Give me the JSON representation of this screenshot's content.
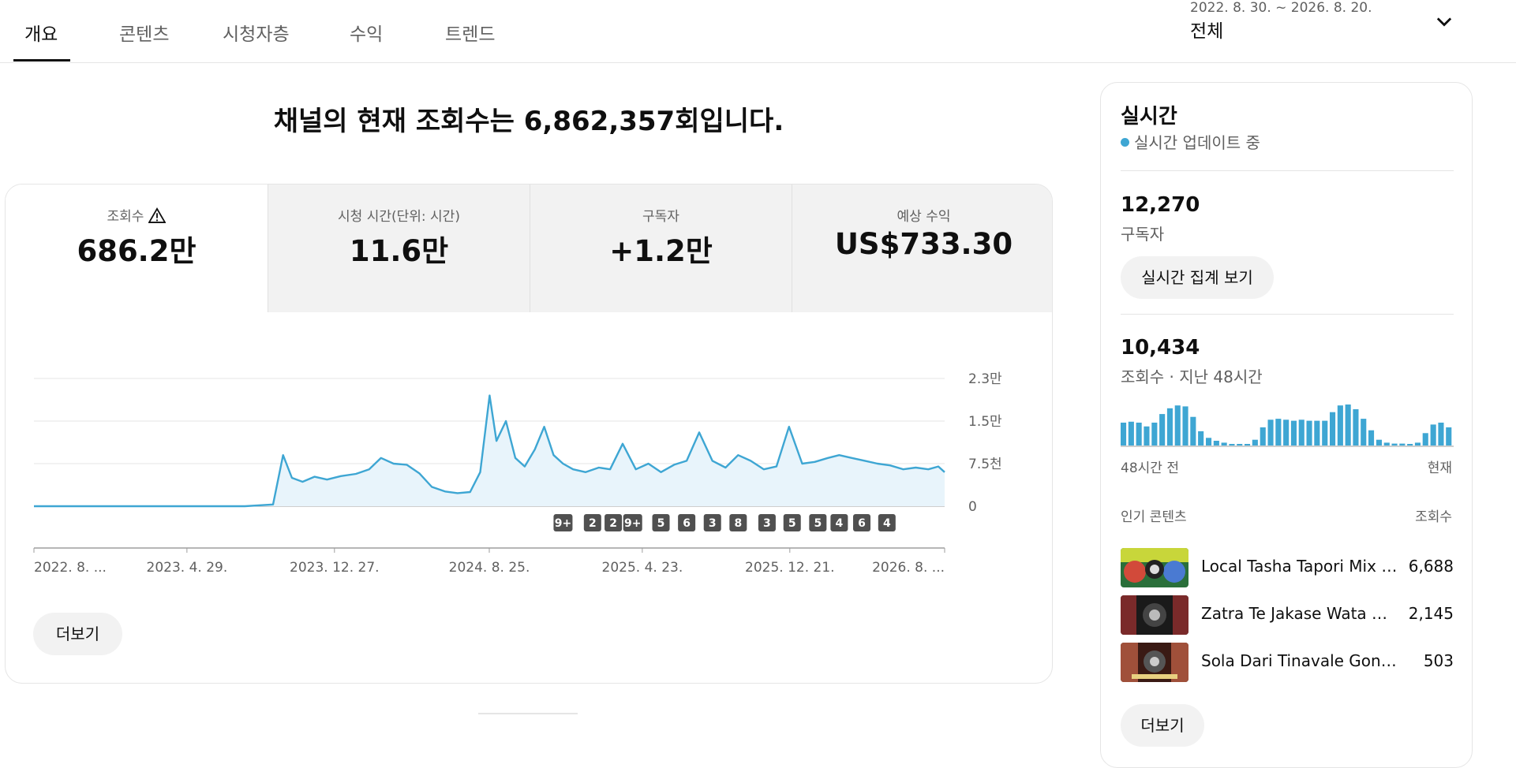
{
  "tabs": [
    {
      "label": "개요",
      "active": true
    },
    {
      "label": "콘텐츠"
    },
    {
      "label": "시청자층"
    },
    {
      "label": "수익"
    },
    {
      "label": "트렌드"
    }
  ],
  "date_range": {
    "range": "2022. 8. 30. ~ 2026. 8. 20.",
    "value": "전체"
  },
  "headline": "채널의 현재 조회수는 6,862,357회입니다.",
  "metrics": [
    {
      "label": "조회수",
      "value": "686.2만"
    },
    {
      "label": "시청 시간(단위: 시간)",
      "value": "11.6만"
    },
    {
      "label": "구독자",
      "value": "+1.2만"
    },
    {
      "label": "예상 수익",
      "value": "US$733.30"
    }
  ],
  "main_more_label": "더보기",
  "colors": {
    "accent": "#3ea6d3",
    "accent_fill": "#e8f4fb",
    "marker": "#505050"
  },
  "chart_data": {
    "type": "line",
    "x_tick_labels": [
      "2022. 8. ...",
      "2023. 4. 29.",
      "2023. 12. 27.",
      "2024. 8. 25.",
      "2025. 4. 23.",
      "2025. 12. 21.",
      "2026. 8. ..."
    ],
    "x_range": [
      "2022-08-30",
      "2026-08-20"
    ],
    "y_tick_labels": [
      "0",
      "7.5천",
      "1.5만",
      "2.3만"
    ],
    "y_ticks": [
      0,
      7500,
      15000,
      22500
    ],
    "ylim": [
      0,
      22500
    ],
    "grid": true,
    "series": [
      {
        "x": [
          "2022-08-30",
          "2023-08-01",
          "2023-09-15",
          "2023-10-01",
          "2023-10-15",
          "2023-11-01",
          "2023-11-20",
          "2023-12-10",
          "2024-01-01",
          "2024-01-25",
          "2024-02-15",
          "2024-03-05",
          "2024-03-25",
          "2024-04-15",
          "2024-05-05",
          "2024-05-25",
          "2024-06-15",
          "2024-07-05",
          "2024-07-25",
          "2024-08-10",
          "2024-08-25",
          "2024-09-05",
          "2024-09-20",
          "2024-10-05",
          "2024-10-20",
          "2024-11-05",
          "2024-11-20",
          "2024-12-05",
          "2024-12-20",
          "2025-01-05",
          "2025-01-25",
          "2025-02-15",
          "2025-03-05",
          "2025-03-25",
          "2025-04-15",
          "2025-05-05",
          "2025-05-25",
          "2025-06-15",
          "2025-07-05",
          "2025-07-25",
          "2025-08-15",
          "2025-09-05",
          "2025-09-25",
          "2025-10-15",
          "2025-11-05",
          "2025-11-25",
          "2025-12-15",
          "2026-01-05",
          "2026-01-25",
          "2026-02-15",
          "2026-03-05",
          "2026-03-25",
          "2026-04-15",
          "2026-05-05",
          "2026-05-25",
          "2026-06-15",
          "2026-07-05",
          "2026-07-25",
          "2026-08-10",
          "2026-08-20"
        ],
        "values": [
          0,
          0,
          300,
          9000,
          5000,
          4300,
          5200,
          4700,
          5300,
          5700,
          6500,
          8500,
          7500,
          7300,
          5800,
          3400,
          2600,
          2300,
          2500,
          6000,
          19500,
          11500,
          15000,
          8500,
          7000,
          10000,
          14000,
          9000,
          7500,
          6500,
          6000,
          6800,
          6500,
          11000,
          6500,
          7500,
          6000,
          7300,
          8000,
          13000,
          8000,
          6800,
          9000,
          8000,
          6500,
          7000,
          14000,
          7500,
          7800,
          8500,
          9000,
          8500,
          8000,
          7500,
          7200,
          6500,
          6800,
          6500,
          7000,
          6000
        ]
      }
    ],
    "markers": [
      {
        "date": "2024-12-20",
        "label": "9+"
      },
      {
        "date": "2025-02-05",
        "label": "2"
      },
      {
        "date": "2025-03-10",
        "label": "2"
      },
      {
        "date": "2025-04-10",
        "label": "9+"
      },
      {
        "date": "2025-05-25",
        "label": "5"
      },
      {
        "date": "2025-07-05",
        "label": "6"
      },
      {
        "date": "2025-08-15",
        "label": "3"
      },
      {
        "date": "2025-09-25",
        "label": "8"
      },
      {
        "date": "2025-11-10",
        "label": "3"
      },
      {
        "date": "2025-12-20",
        "label": "5"
      },
      {
        "date": "2026-01-30",
        "label": "5"
      },
      {
        "date": "2026-03-05",
        "label": "4"
      },
      {
        "date": "2026-04-10",
        "label": "6"
      },
      {
        "date": "2026-05-20",
        "label": "4"
      }
    ]
  },
  "realtime": {
    "title": "실시간",
    "live_label": "실시간 업데이트 중",
    "subscribers_value": "12,270",
    "subscribers_label": "구독자",
    "realtime_button": "실시간 집계 보기",
    "views_value": "10,434",
    "views_label": "조회수 · 지난 48시간",
    "mini_chart": {
      "type": "bar",
      "values": [
        240,
        250,
        240,
        200,
        240,
        330,
        390,
        420,
        410,
        300,
        150,
        80,
        50,
        30,
        10,
        10,
        10,
        60,
        190,
        270,
        280,
        270,
        260,
        270,
        260,
        260,
        260,
        350,
        420,
        430,
        380,
        280,
        160,
        60,
        30,
        20,
        20,
        10,
        30,
        130,
        220,
        240,
        190
      ],
      "left_label": "48시간 전",
      "right_label": "현재"
    },
    "popular_header": "인기 콘텐츠",
    "views_header": "조회수",
    "videos": [
      {
        "title": "Local Tasha Tapori Mix Dj Remix | M...",
        "views": "6,688"
      },
      {
        "title": "Zatra Te Jakase Wata Dj Song | Zat...",
        "views": "2,145"
      },
      {
        "title": "Sola Dari Tinavale Gondi Song | Gondi...",
        "views": "503"
      }
    ],
    "more_button": "더보기"
  }
}
